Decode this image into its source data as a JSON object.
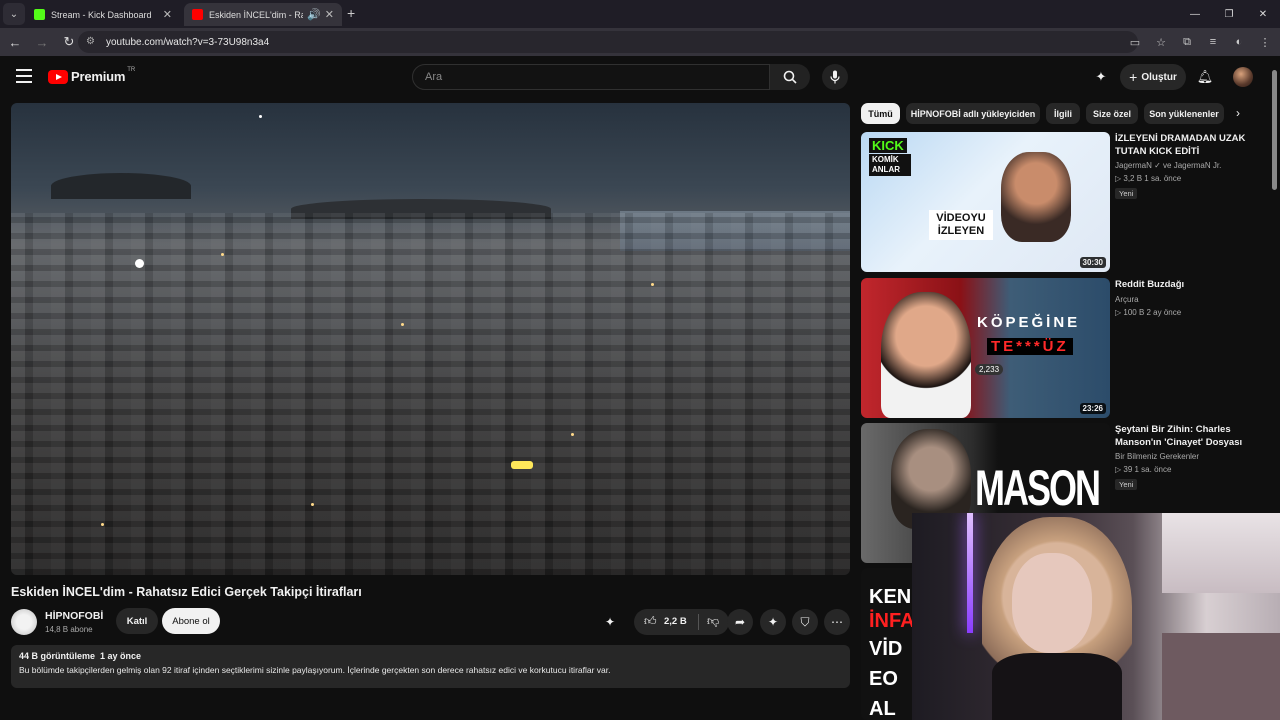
{
  "browser": {
    "tabs": [
      {
        "title": "Stream - Kick Dashboard",
        "active": false,
        "favicon_color": "#53fc18"
      },
      {
        "title": "Eskiden İNCEL'dim - Rahats",
        "active": true,
        "favicon_color": "#ff0000"
      }
    ],
    "url": "youtube.com/watch?v=3-73U98n3a4"
  },
  "youtube": {
    "logo_text": "Premium",
    "logo_region": "TR",
    "search_placeholder": "Ara",
    "create_label": "Oluştur"
  },
  "video": {
    "title": "Eskiden İNCEL'dim - Rahatsız Edici Gerçek Takipçi İtirafları",
    "channel": "HİPNOFOBİ",
    "subscribers": "14,8 B abone",
    "join_label": "Katıl",
    "subscribe_label": "Abone ol",
    "likes": "2,2 B",
    "views": "44 B görüntüleme",
    "age": "1 ay önce",
    "description": "Bu bölümde takipçilerden gelmiş olan 92 itiraf içinden seçtiklerimi sizinle paylaşıyorum. İçlerinde gerçekten son derece rahatsız edici ve korkutucu itiraflar var."
  },
  "chips": [
    "Tümü",
    "HİPNOFOBİ adlı yükleyiciden",
    "İlgili",
    "Size özel",
    "Son yüklenenler"
  ],
  "recommendations": [
    {
      "title": "İZLEYENİ DRAMADAN UZAK TUTAN KICK EDİTİ",
      "channel": "JagermaN ✓ ve JagermaN Jr.",
      "stats": "3,2 B  1 sa. önce",
      "badge": "Yeni",
      "duration": "30:30",
      "thumb_text_1": "KICK",
      "thumb_text_2": "KOMİK ANLAR",
      "thumb_text_3": "VİDEOYU İZLEYEN"
    },
    {
      "title": "Reddit Buzdağı",
      "channel": "Arçura",
      "stats": "100 B  2 ay önce",
      "badge": "",
      "duration": "23:26",
      "thumb_text_1": "KÖPEĞİNE",
      "thumb_text_2": "TE***ÜZ",
      "thumb_text_3": "2,233"
    },
    {
      "title": "Şeytani Bir Zihin: Charles Manson'ın 'Cinayet' Dosyası",
      "channel": "Bir Bilmeniz Gerekenler",
      "stats": "39  1 sa. önce",
      "badge": "Yeni",
      "duration": "",
      "thumb_text_1": "MASON",
      "thumb_text_2": "",
      "thumb_text_3": ""
    },
    {
      "title": "",
      "channel": "",
      "stats": "",
      "badge": "",
      "duration": "",
      "thumb_text_1": "KEND",
      "thumb_text_2": "İNFAZ",
      "thumb_text_3": "VİDEO ALD"
    }
  ]
}
